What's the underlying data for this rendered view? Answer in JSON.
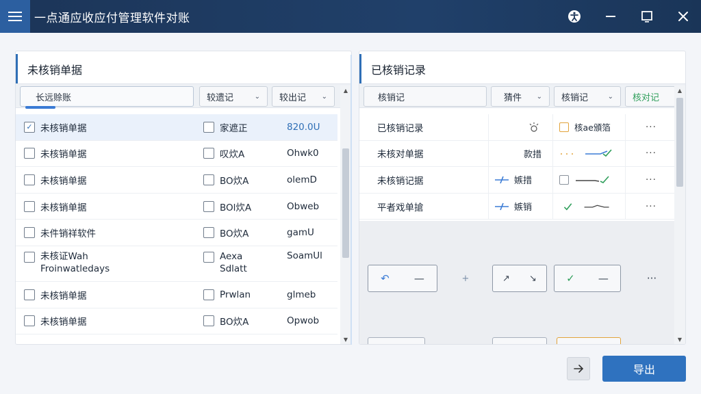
{
  "window": {
    "title": "一点通应收应付管理软件对账"
  },
  "left_panel": {
    "title": "未核销单据",
    "search": {
      "value": "长远赊账"
    },
    "filters": [
      {
        "label": "较遗记"
      },
      {
        "label": "较出记"
      }
    ],
    "rows": [
      {
        "name": "未核销单据",
        "checked": true,
        "status": "家遮正",
        "value": "820.0U"
      },
      {
        "name": "未核销单据",
        "status": "叹炊A",
        "value": "Ohwk0"
      },
      {
        "name": "未核销单据",
        "status": "BO炊A",
        "value": "olemD"
      },
      {
        "name": "未核销单据",
        "status": "BOl炊A",
        "value": "Obweb"
      },
      {
        "name": "未件销祥软件",
        "status": "BO炊A",
        "value": "gamU"
      },
      {
        "name_line1": "未核证Wah",
        "name_line2": "Froinwatledays",
        "status_line1": "Aexa",
        "status_line2": "Sdlatt",
        "value": "SoamUl"
      },
      {
        "name": "未核销单据",
        "status": "Prwlan",
        "value": "glmeb"
      },
      {
        "name": "未核销单据",
        "status": "BO炊A",
        "value": "Opwob"
      }
    ]
  },
  "right_panel": {
    "title": "已核销记录",
    "filters": [
      {
        "label": "核销记"
      },
      {
        "label": "猜件"
      },
      {
        "label": "核销记"
      },
      {
        "label": "核对记"
      }
    ],
    "rows": [
      {
        "name": "已核销记录",
        "action": "",
        "tag": "核ae頒箔",
        "more": "···"
      },
      {
        "name": "未核对单据",
        "action": "款措",
        "tag": "",
        "more": "···"
      },
      {
        "name": "未核销记据",
        "action": "嫉措",
        "tag": "",
        "more": "···"
      },
      {
        "name": "平者戏单搶",
        "action": "嫉销",
        "tag": "",
        "more": "···"
      }
    ],
    "controls": {
      "more": "···"
    }
  },
  "footer": {
    "export_label": "导出"
  },
  "colors": {
    "titlebar": "#1c3558",
    "accent": "#2f72bf",
    "green": "#2e9e5a",
    "orange": "#e2a33a"
  }
}
